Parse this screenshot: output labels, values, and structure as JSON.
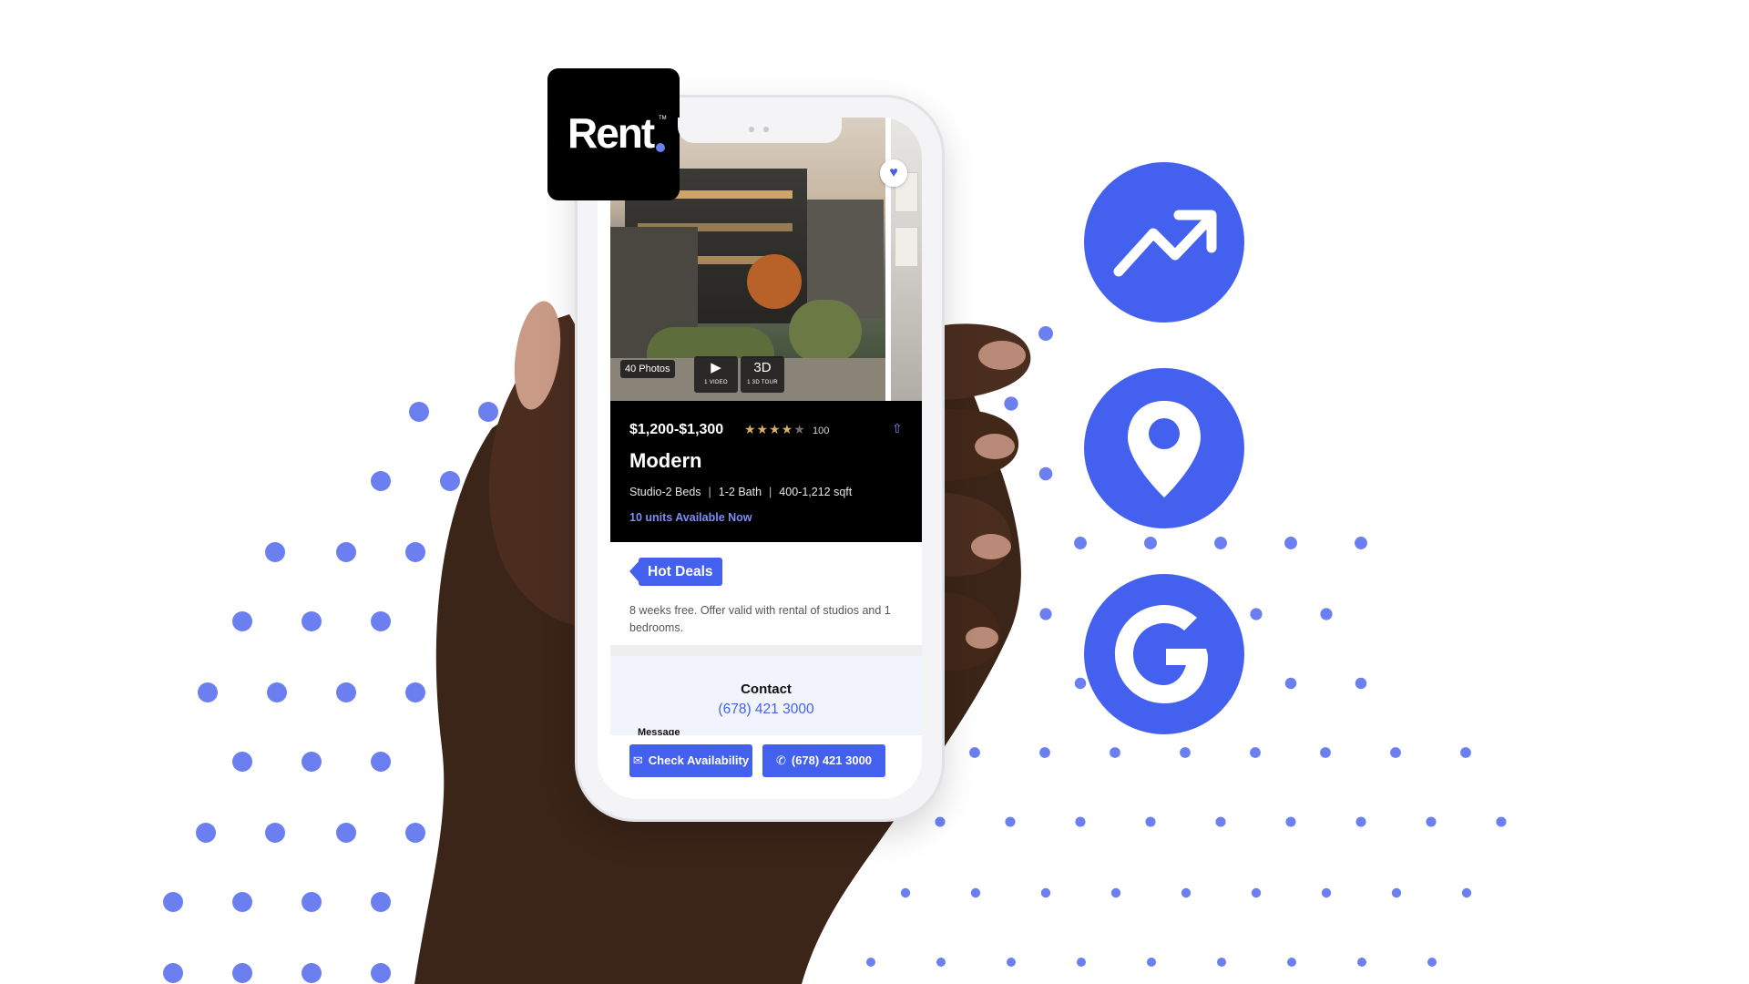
{
  "brand": {
    "logo_text": "Rent",
    "accent_color": "#4361ee",
    "dot_color": "#6b7ff0"
  },
  "listing": {
    "photo_count_label": "40 Photos",
    "video_button": {
      "icon": "play-icon",
      "label": "1 VIDEO"
    },
    "tour_button": {
      "big": "3D",
      "label": "1 3D TOUR"
    },
    "favorite_icon": "heart-icon",
    "price": "$1,200-$1,300",
    "rating_stars": 4,
    "rating_max": 5,
    "review_count": "100",
    "share_icon": "share-icon",
    "name": "Modern",
    "beds": "Studio-2 Beds",
    "baths": "1-2 Bath",
    "sqft": "400-1,212 sqft",
    "availability": "10 units Available Now"
  },
  "deals": {
    "tag_label": "Hot Deals",
    "description": "8 weeks free. Offer valid with rental of studios and 1 bedrooms."
  },
  "contact": {
    "title": "Contact",
    "phone": "(678) 421 3000",
    "message_label": "Message",
    "check_availability_label": "Check Availability",
    "check_availability_icon": "mail-icon",
    "call_label": "(678) 421 3000",
    "call_icon": "phone-icon"
  },
  "features": [
    {
      "icon": "trending-up-icon"
    },
    {
      "icon": "location-pin-icon"
    },
    {
      "icon": "google-icon"
    }
  ]
}
